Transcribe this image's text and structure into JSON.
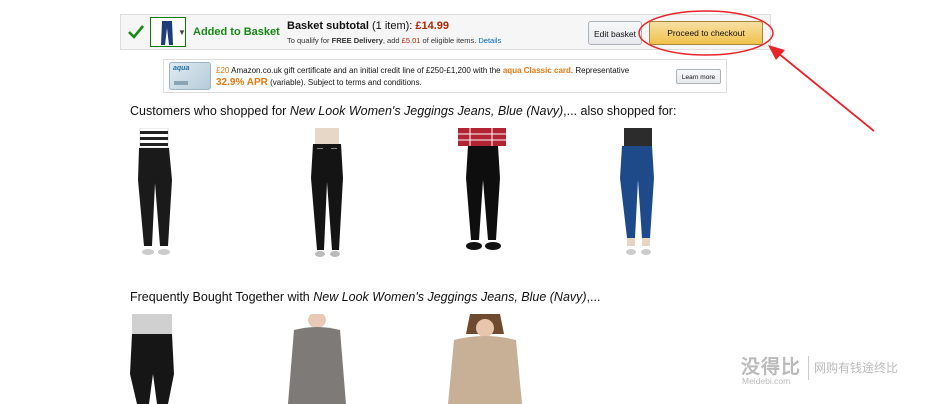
{
  "basket": {
    "added_label": "Added to Basket",
    "subtotal_label": "Basket subtotal",
    "item_count": "(1 item):",
    "price": "£14.99",
    "delivery_pre": "To qualify for ",
    "delivery_bold": "FREE Delivery",
    "delivery_mid": ", add ",
    "delivery_amount": "£5.01",
    "delivery_post": " of eligible items.",
    "details_link": "Details",
    "edit_button": "Edit basket",
    "checkout_button": "Proceed to checkout"
  },
  "aqua": {
    "logo": "aqua",
    "amount": "£20",
    "line1_rest": " Amazon.co.uk gift certificate and an initial credit line of £250-£1,200 with the ",
    "card_name": "aqua Classic card",
    "line1_end": ". Representative",
    "apr": "32.9% APR",
    "line2_rest": " (variable). Subject to terms and conditions.",
    "learn_more": "Learn more"
  },
  "section1": {
    "prefix": "Customers who shopped for ",
    "product": "New Look Women's Jeggings Jeans, Blue (Navy)",
    "suffix": ",... also shopped for:"
  },
  "section2": {
    "prefix": "Frequently Bought Together with ",
    "product": "New Look Women's Jeggings Jeans, Blue (Navy)",
    "suffix": ",..."
  },
  "watermark": {
    "name": "没得比",
    "slogan": "网购有钱途终比",
    "url": "Meidebi.com"
  },
  "colors": {
    "accent_red": "#b12704",
    "added_green": "#168a16",
    "checkout_yellow": "#f0c14b",
    "annotation_red": "#e8232a",
    "aqua_orange": "#e47911",
    "link_blue": "#0066c0"
  }
}
